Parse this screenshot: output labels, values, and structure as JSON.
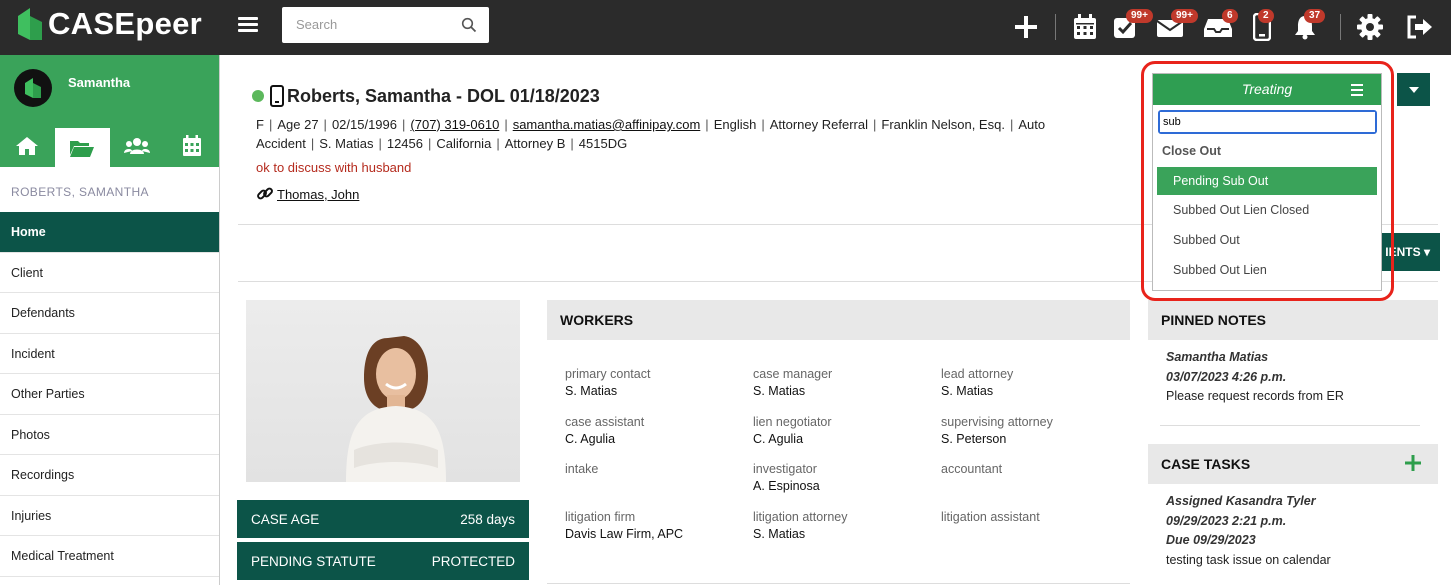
{
  "app": {
    "name": "CASEpeer"
  },
  "search": {
    "placeholder": "Search"
  },
  "toolbar": {
    "icons": [
      "plus-icon",
      "calendar-icon",
      "tasks-icon",
      "mail-icon",
      "inbox-icon",
      "mobile-icon",
      "bell-icon",
      "gear-icon",
      "logout-icon"
    ],
    "badges": {
      "tasks": "99+",
      "mail": "99+",
      "inbox": "6",
      "mobile": "2",
      "bell": "37"
    }
  },
  "sidebar": {
    "user_name": "Samantha",
    "case_label": "ROBERTS, SAMANTHA",
    "items": [
      "Home",
      "Client",
      "Defendants",
      "Incident",
      "Other Parties",
      "Photos",
      "Recordings",
      "Injuries",
      "Medical Treatment"
    ]
  },
  "case": {
    "title": "Roberts, Samantha - DOL 01/18/2023",
    "meta": [
      "F",
      "Age 27",
      "02/15/1996",
      "(707) 319-0610",
      "samantha.matias@affinipay.com",
      "English",
      "Attorney Referral",
      "Franklin Nelson, Esq.",
      "Auto Accident",
      "S. Matias",
      "12456",
      "California",
      "Attorney B",
      "4515DG"
    ],
    "meta_line1": {
      "gender": "F",
      "age": "Age 27",
      "dob": "02/15/1996",
      "phone": "(707) 319-0610",
      "email": "samantha.matias@affinipay.com",
      "language": "English",
      "referral": "Attorney Referral",
      "referrer": "Franklin Nelson, Esq.",
      "type_start": "Auto"
    },
    "meta_line2": {
      "type_end": "Accident",
      "staff": "S. Matias",
      "number": "12456",
      "state": "California",
      "attorney": "Attorney B",
      "code": "4515DG"
    },
    "note": "ok to discuss with husband",
    "linked_contact": "Thomas, John",
    "docs_button": "IENTS"
  },
  "stats": [
    {
      "label": "CASE AGE",
      "value": "258 days"
    },
    {
      "label": "PENDING STATUTE",
      "value": "PROTECTED"
    }
  ],
  "workers": {
    "title": "WORKERS",
    "cells": [
      {
        "label": "primary contact",
        "value": "S. Matias"
      },
      {
        "label": "case manager",
        "value": "S. Matias"
      },
      {
        "label": "lead attorney",
        "value": "S. Matias"
      },
      {
        "label": "case assistant",
        "value": "C. Agulia"
      },
      {
        "label": "lien negotiator",
        "value": "C. Agulia"
      },
      {
        "label": "supervising attorney",
        "value": "S. Peterson"
      },
      {
        "label": "intake",
        "value": ""
      },
      {
        "label": "investigator",
        "value": "A. Espinosa"
      },
      {
        "label": "accountant",
        "value": ""
      },
      {
        "label": "litigation firm",
        "value": "Davis Law Firm, APC"
      },
      {
        "label": "litigation attorney",
        "value": "S. Matias"
      },
      {
        "label": "litigation assistant",
        "value": ""
      }
    ]
  },
  "pinned_notes": {
    "title": "PINNED NOTES",
    "author": "Samantha Matias",
    "date": "03/07/2023 4:26 p.m.",
    "text": "Please request records from ER"
  },
  "case_tasks": {
    "title": "CASE TASKS",
    "assigned": "Assigned Kasandra Tyler",
    "date": "09/29/2023 2:21 p.m.",
    "due": "Due 09/29/2023",
    "text": "testing task issue on calendar"
  },
  "status_dropdown": {
    "current": "Treating",
    "search_value": "sub",
    "group": "Close Out",
    "options": [
      "Pending Sub Out",
      "Subbed Out Lien Closed",
      "Subbed Out",
      "Subbed Out Lien"
    ],
    "highlighted": "Pending Sub Out"
  },
  "colors": {
    "top_bar": "#2b2b2b",
    "brand_green": "#3aa35a",
    "dark_teal": "#0c5448",
    "highlight_red": "#e8231b"
  }
}
